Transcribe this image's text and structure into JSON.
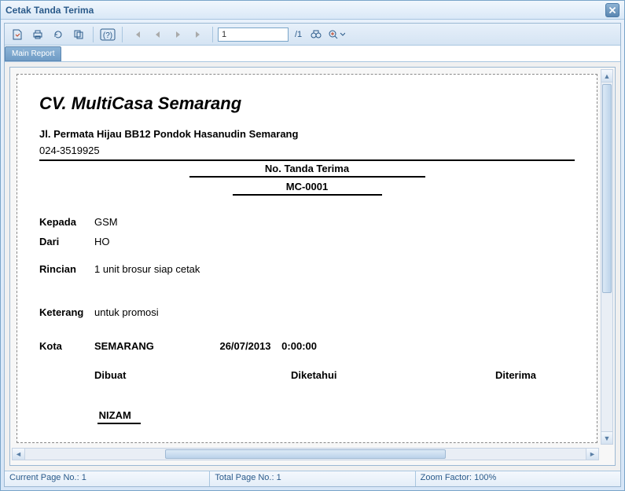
{
  "window": {
    "title": "Cetak Tanda Terima"
  },
  "toolbar": {
    "page_current": "1",
    "page_total": "/1"
  },
  "tabs": {
    "main": "Main Report"
  },
  "status": {
    "current_page_label": "Current Page No.: ",
    "current_page_value": "1",
    "total_page_label": "Total Page No.: ",
    "total_page_value": "1",
    "zoom_label": "Zoom Factor: ",
    "zoom_value": "100%"
  },
  "report": {
    "company": "CV. MultiCasa Semarang",
    "address": "Jl. Permata Hijau BB12 Pondok Hasanudin Semarang",
    "phone": "024-3519925",
    "no_label": "No. Tanda Terima",
    "no_value": "MC-0001",
    "labels": {
      "kepada": "Kepada",
      "dari": "Dari",
      "rincian": "Rincian",
      "keterang": "Keterang",
      "kota": "Kota"
    },
    "values": {
      "kepada": "GSM",
      "dari": "HO",
      "rincian": "1 unit brosur siap cetak",
      "keterang": "untuk promosi",
      "kota": "SEMARANG",
      "date": "26/07/2013",
      "time": "0:00:00"
    },
    "sig": {
      "dibuat": "Dibuat",
      "diketahui": "Diketahui",
      "diterima": "Diterima",
      "name": "NIZAM"
    }
  }
}
